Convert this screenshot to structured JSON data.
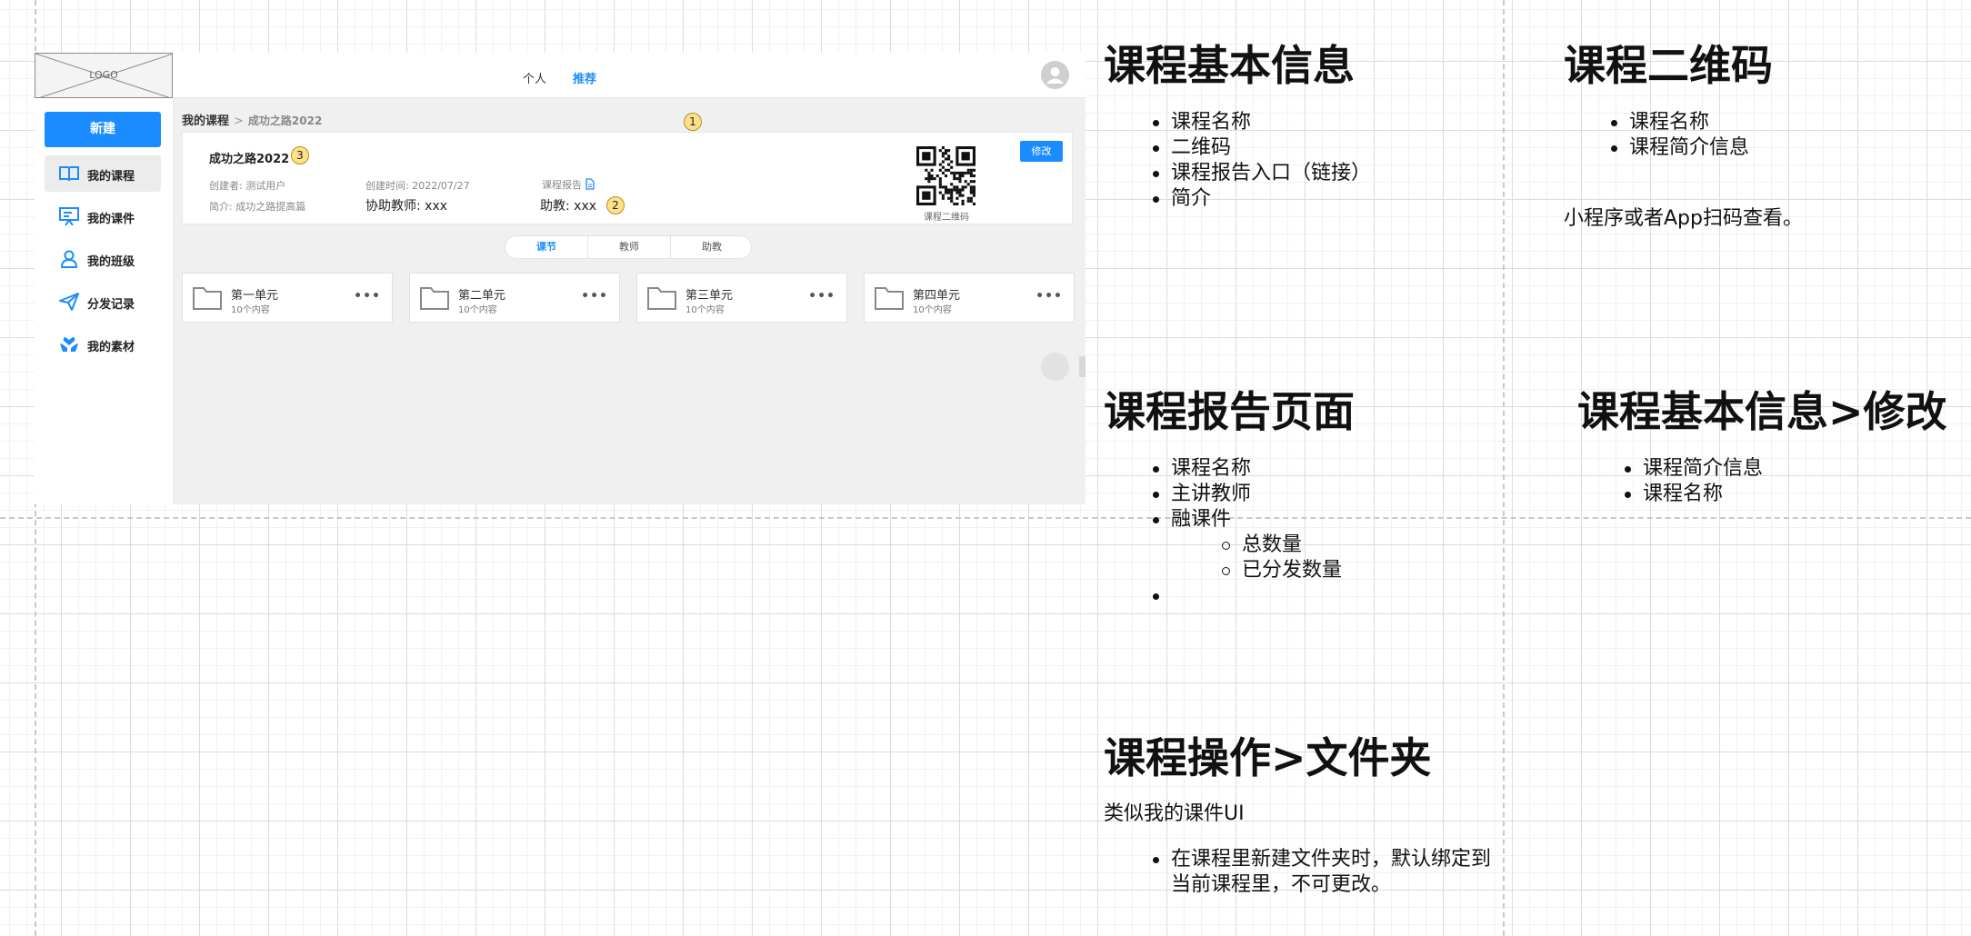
{
  "app": {
    "logo_text": "LOGO",
    "nav": [
      "个人",
      "推荐"
    ],
    "active_nav": "推荐",
    "sidebar": {
      "new_button": "新建",
      "items": [
        {
          "label": "我的课程",
          "icon": "book-icon",
          "active": true
        },
        {
          "label": "我的课件",
          "icon": "presentation-icon",
          "active": false
        },
        {
          "label": "我的班级",
          "icon": "person-icon",
          "active": false
        },
        {
          "label": "分发记录",
          "icon": "send-icon",
          "active": false
        },
        {
          "label": "我的素材",
          "icon": "hands-icon",
          "active": false
        }
      ]
    },
    "breadcrumb": {
      "root": "我的课程",
      "separator": ">",
      "current": "成功之路2022"
    },
    "course": {
      "title": "成功之路2022",
      "creator_label": "创建者:",
      "creator": "测试用户",
      "created_label": "创建时间:",
      "created": "2022/07/27",
      "report_label": "课程报告",
      "intro_label": "简介:",
      "intro": "成功之路提高篇",
      "assist_teacher_label": "协助教师:",
      "assist_teacher": "xxx",
      "assistant_label": "助教:",
      "assistant": "xxx",
      "edit_button": "修改",
      "qr_caption": "课程二维码"
    },
    "tabs": [
      "课节",
      "教师",
      "助教"
    ],
    "active_tab": "课节",
    "folders": [
      {
        "name": "第一单元",
        "count": "10个内容"
      },
      {
        "name": "第二单元",
        "count": "10个内容"
      },
      {
        "name": "第三单元",
        "count": "10个内容"
      },
      {
        "name": "第四单元",
        "count": "10个内容"
      }
    ],
    "badges": [
      "1",
      "2",
      "3"
    ],
    "colors": {
      "accent": "#1a8cff",
      "badge": "#ffe08a"
    }
  },
  "annotations": {
    "basic_info": {
      "title": "课程基本信息",
      "items": [
        "课程名称",
        "二维码",
        "课程报告入口（链接）",
        "简介"
      ]
    },
    "qr_code": {
      "title": "课程二维码",
      "items": [
        "课程名称",
        "课程简介信息"
      ],
      "note": "小程序或者App扫码查看。"
    },
    "report_page": {
      "title": "课程报告页面",
      "items": [
        "课程名称",
        "主讲教师",
        "融课件"
      ],
      "subitems": [
        "总数量",
        "已分发数量"
      ],
      "trailing": ""
    },
    "edit_info": {
      "title": "课程基本信息>修改",
      "items": [
        "课程简介信息",
        "课程名称"
      ]
    },
    "folder_ops": {
      "title": "课程操作>文件夹",
      "note": "类似我的课件UI",
      "items": [
        "在课程里新建文件夹时，默认绑定到",
        "当前课程里，不可更改。"
      ]
    }
  }
}
